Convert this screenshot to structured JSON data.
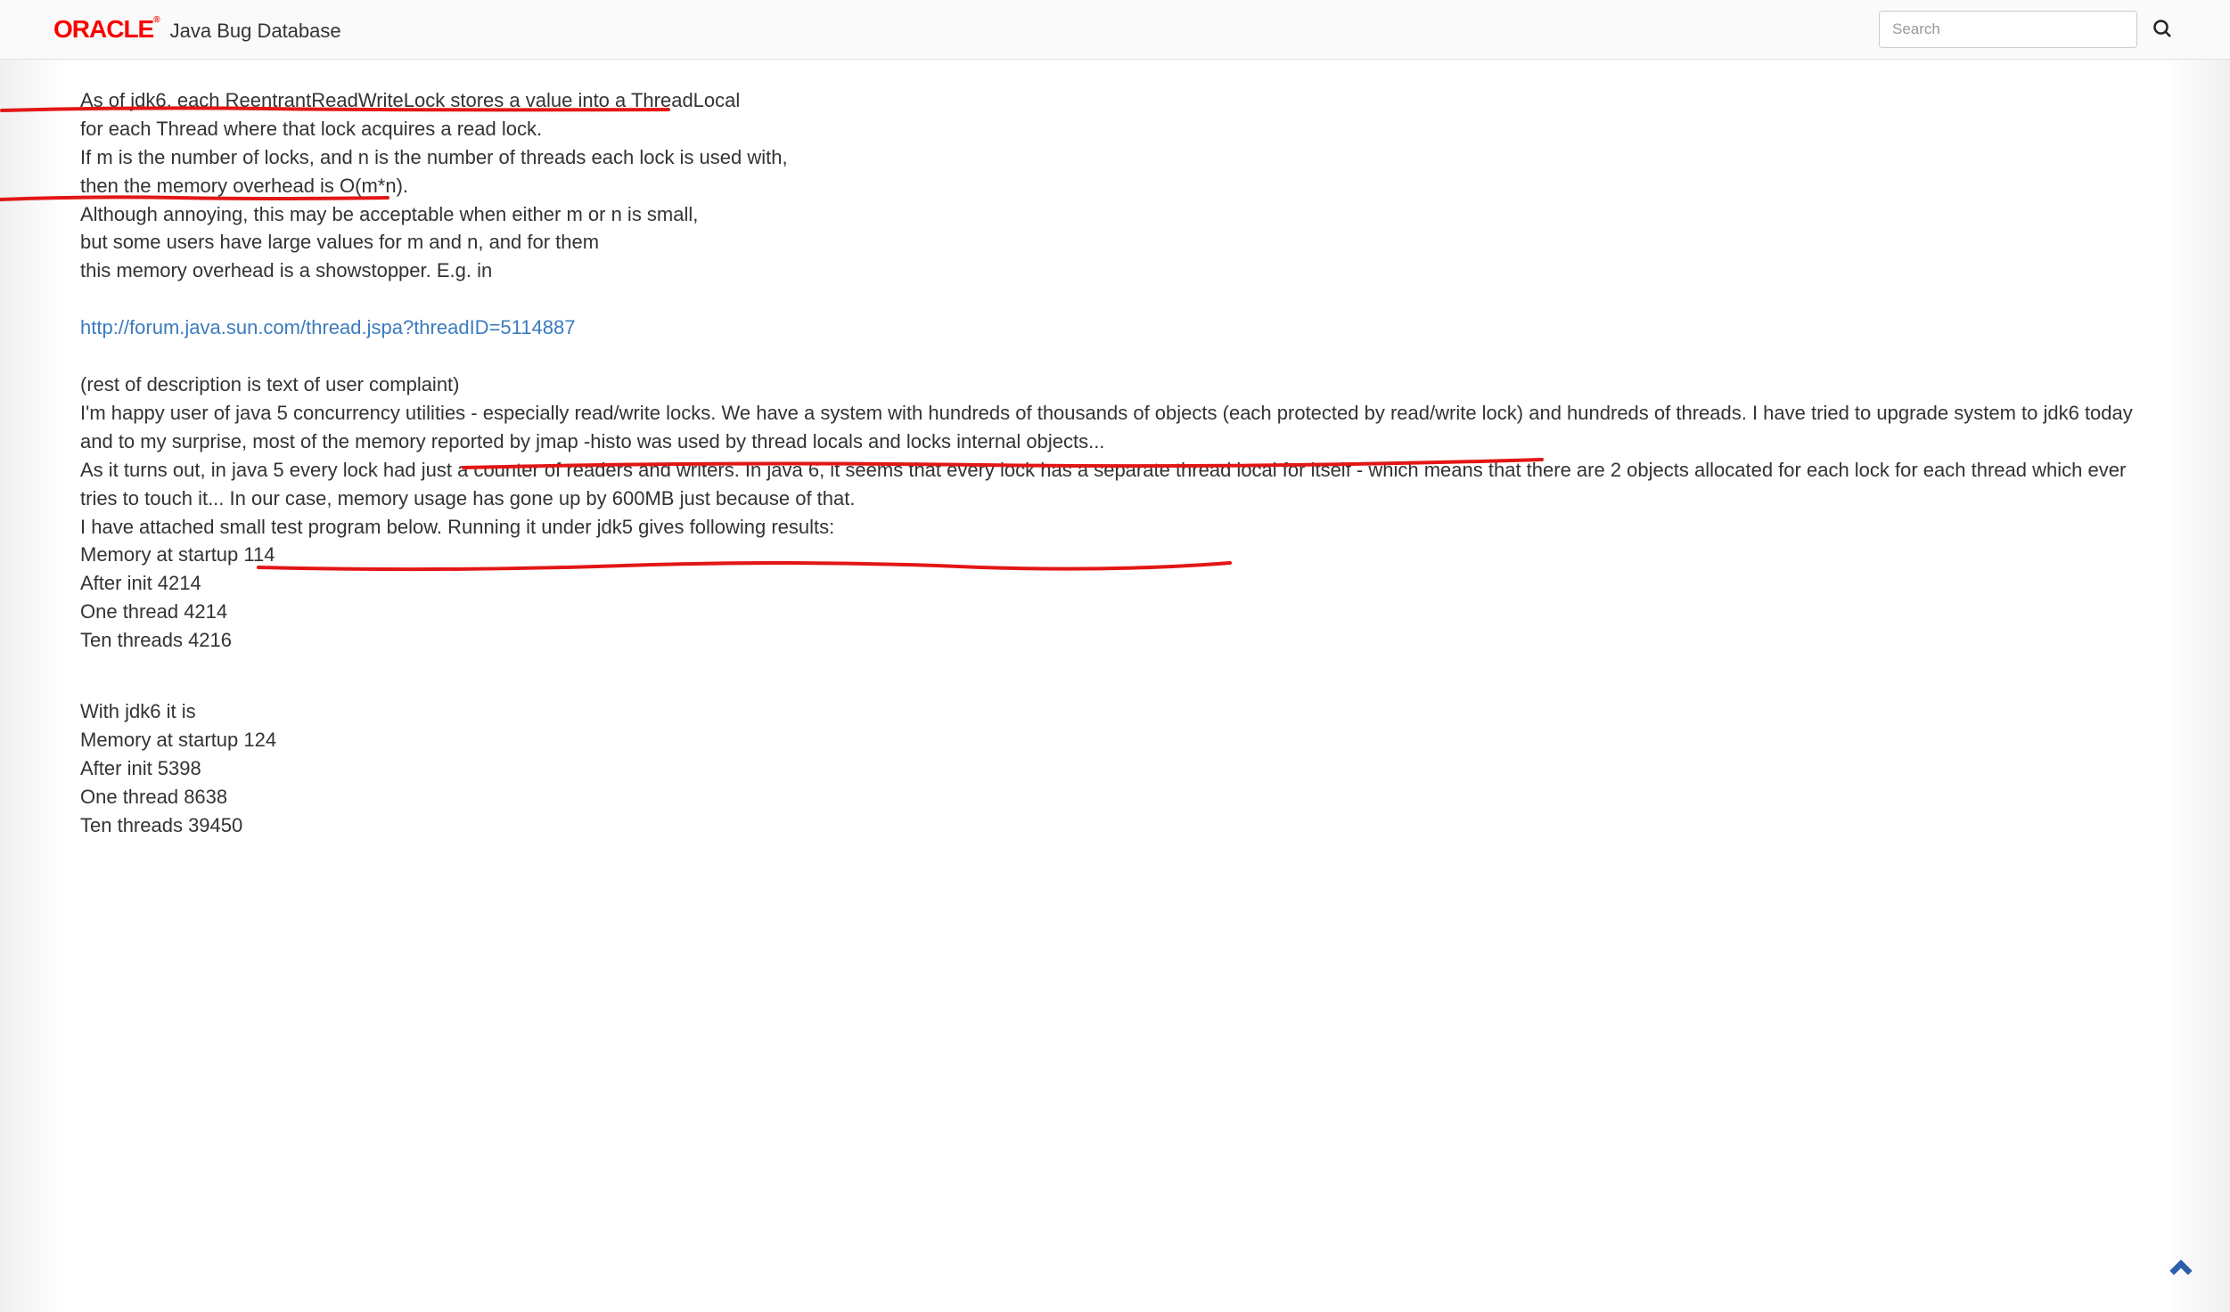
{
  "header": {
    "logo_text": "ORACLE",
    "site_title": "Java Bug Database",
    "search_placeholder": "Search"
  },
  "content": {
    "line1": "As of jdk6, each ReentrantReadWriteLock stores a value into a ThreadLocal",
    "line2": "for each Thread where that lock acquires a read lock.",
    "line3": "If m is the number of locks, and n is the number of threads each lock is used with,",
    "line4": "then the memory overhead is O(m*n).",
    "line5": "Although annoying, this may be acceptable when either m or n is small,",
    "line6": "but some users have large values for m and n, and for them",
    "line7": "this memory overhead is a showstopper.  E.g. in",
    "link_url": "http://forum.java.sun.com/thread.jspa?threadID=5114887",
    "line8": "(rest of description is text of user complaint)",
    "para1": "I'm happy user of java 5 concurrency utilities - especially read/write locks. We have a system with hundreds of thousands of objects (each protected by read/write lock) and hundreds of threads. I have tried to upgrade system to jdk6 today and to my surprise, most of the memory reported by jmap -histo was used by thread locals and locks internal objects...",
    "para2": "As it turns out, in java 5 every lock had just a counter of readers and writers. In java 6, it seems that every lock has a separate thread local for itself - which means that there are 2 objects allocated for each lock for each thread which ever tries to touch it... In our case, memory usage has gone up by 600MB just because of that.",
    "para3": "I have attached small test program below. Running it under jdk5 gives following results:",
    "jdk5_1": "Memory at startup 114",
    "jdk5_2": "After init 4214",
    "jdk5_3": "One thread 4214",
    "jdk5_4": "Ten threads 4216",
    "with_jdk6": "With jdk6 it is",
    "jdk6_1": "Memory at startup 124",
    "jdk6_2": "After init 5398",
    "jdk6_3": "One thread 8638",
    "jdk6_4": "Ten threads 39450"
  }
}
